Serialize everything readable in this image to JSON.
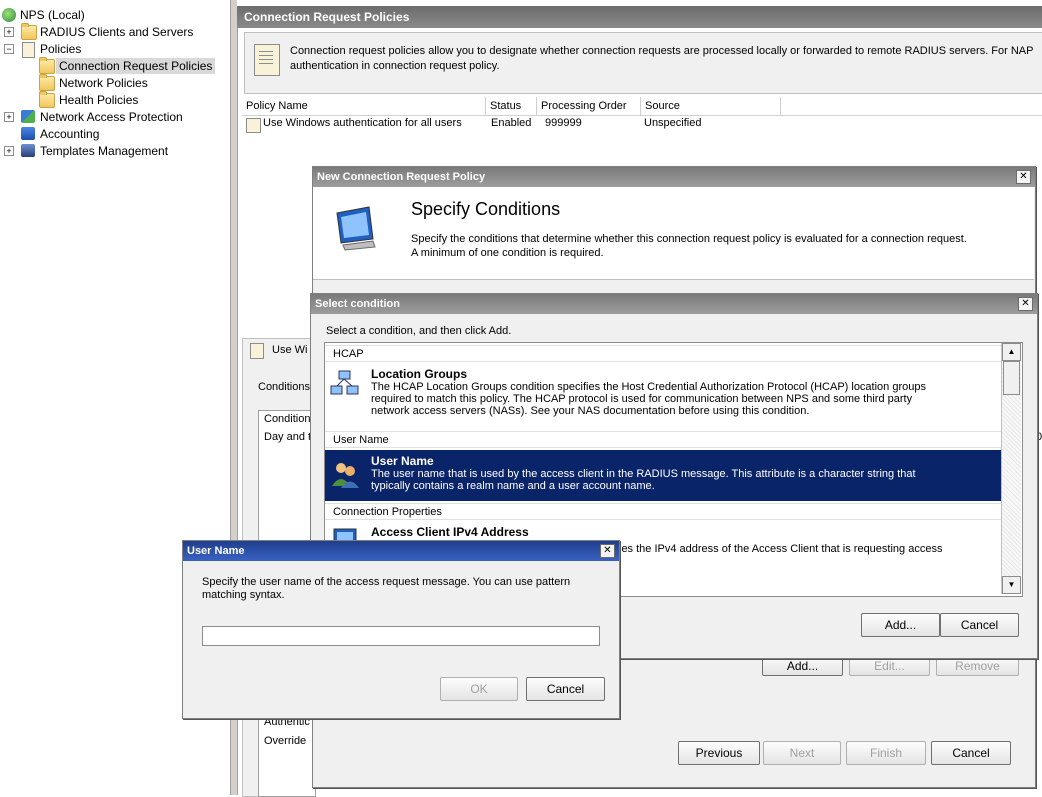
{
  "tree": {
    "root": "NPS (Local)",
    "items": [
      {
        "label": "RADIUS Clients and Servers",
        "expander": "+"
      },
      {
        "label": "Policies",
        "expander": "−"
      },
      {
        "label": "Connection Request Policies"
      },
      {
        "label": "Network Policies"
      },
      {
        "label": "Health Policies"
      },
      {
        "label": "Network Access Protection",
        "expander": "+"
      },
      {
        "label": "Accounting"
      },
      {
        "label": "Templates Management",
        "expander": "+"
      }
    ]
  },
  "main": {
    "header": "Connection Request Policies",
    "description_line1": "Connection request policies allow you to designate whether connection requests are processed locally or forwarded to remote RADIUS servers. For NAP",
    "description_line2": "authentication in connection request policy.",
    "columns": [
      "Policy Name",
      "Status",
      "Processing Order",
      "Source"
    ],
    "rows": [
      {
        "name": "Use Windows authentication for all users",
        "status": "Enabled",
        "order": "999999",
        "source": "Unspecified"
      }
    ],
    "behind_labels": [
      "Use Wi",
      "Conditions",
      "Condition",
      "Day and t",
      "Authentic",
      "Override",
      "0"
    ]
  },
  "wizard": {
    "title": "New Connection Request Policy",
    "heading": "Specify Conditions",
    "desc_line1": "Specify the conditions that determine whether this connection request policy is evaluated for a connection request.",
    "desc_line2": "A minimum of one condition is required.",
    "buttons": {
      "add": "Add...",
      "edit": "Edit...",
      "remove": "Remove",
      "previous": "Previous",
      "next": "Next",
      "finish": "Finish",
      "cancel": "Cancel"
    }
  },
  "select_condition": {
    "title": "Select condition",
    "instruction": "Select a condition, and then click Add.",
    "groups": [
      {
        "name": "HCAP"
      },
      {
        "name": "User Name"
      },
      {
        "name": "Connection Properties"
      }
    ],
    "items": [
      {
        "name": "Location Groups",
        "icon": "location-groups-icon",
        "desc": [
          "The HCAP Location Groups condition specifies the Host Credential Authorization Protocol (HCAP) location groups",
          "required to match this policy. The HCAP protocol is used for communication between NPS and some third party",
          "network access servers (NASs). See your NAS documentation before using this condition."
        ]
      },
      {
        "name": "User Name",
        "icon": "users-icon",
        "desc": [
          "The user name that is used by the access client in the RADIUS message. This attribute is a character string that",
          "typically contains a realm name and a user account name."
        ]
      },
      {
        "name": "Access Client IPv4 Address",
        "icon": "computer-icon",
        "desc": [
          "ies the IPv4 address of the Access Client that is requesting access"
        ]
      }
    ],
    "buttons": {
      "add": "Add...",
      "cancel": "Cancel"
    }
  },
  "user_name_dialog": {
    "title": "User Name",
    "desc_line1": "Specify the user name of the access request message. You can use pattern",
    "desc_line2": "matching syntax.",
    "input_value": "",
    "buttons": {
      "ok": "OK",
      "cancel": "Cancel"
    }
  },
  "colors": {
    "highlight": "#0a246a",
    "titlebar": "#8b8b8b",
    "dialog_bg": "#f0f0f0"
  }
}
